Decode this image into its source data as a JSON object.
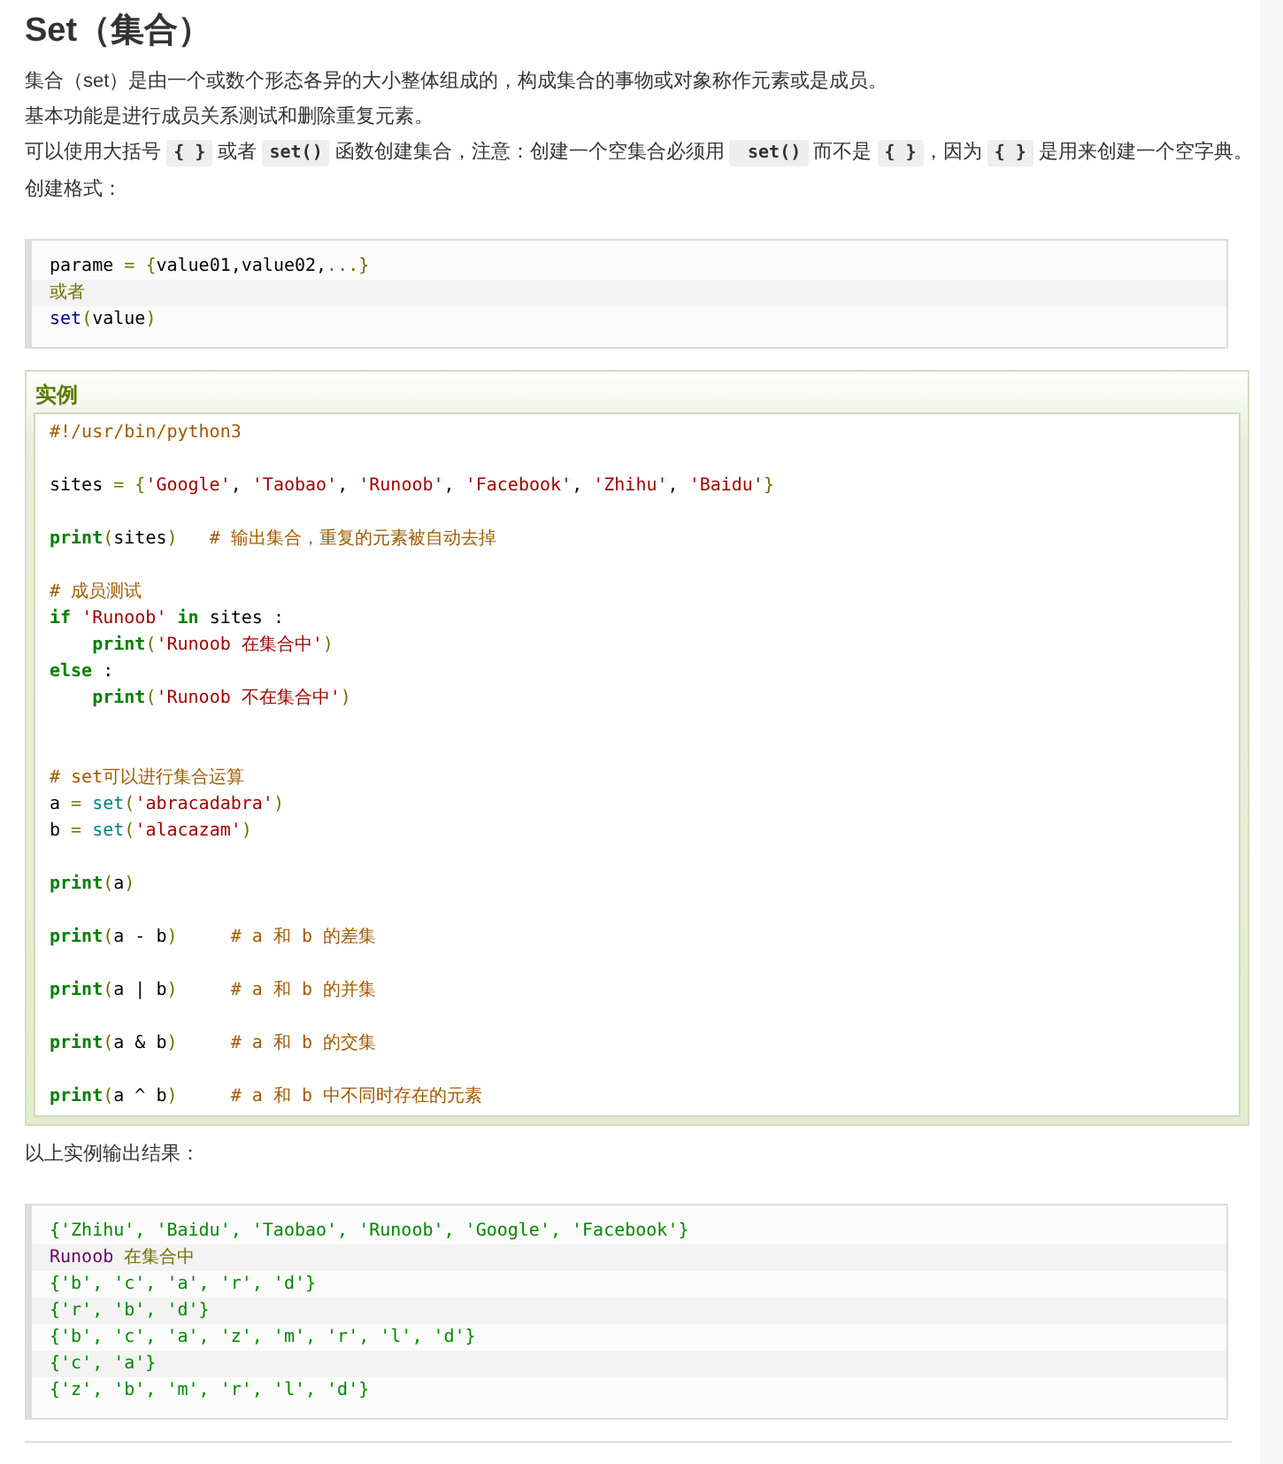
{
  "title": "Set（集合）",
  "paragraphs": [
    [
      {
        "kind": "text",
        "text": "集合（set）是由一个或数个形态各异的大小整体组成的，构成集合的事物或对象称作元素或是成员。"
      }
    ],
    [
      {
        "kind": "text",
        "text": "基本功能是进行成员关系测试和删除重复元素。"
      }
    ],
    [
      {
        "kind": "text",
        "text": "可以使用大括号 "
      },
      {
        "kind": "code",
        "text": "{ }"
      },
      {
        "kind": "text",
        "text": " 或者 "
      },
      {
        "kind": "code",
        "text": "set()"
      },
      {
        "kind": "text",
        "text": " 函数创建集合，注意：创建一个空集合必须用 "
      },
      {
        "kind": "code",
        "text": " set()"
      },
      {
        "kind": "text",
        "text": " 而不是 "
      },
      {
        "kind": "code",
        "text": "{ }"
      },
      {
        "kind": "text",
        "text": "，因为 "
      },
      {
        "kind": "code",
        "text": "{ }"
      },
      {
        "kind": "text",
        "text": " 是用来创建一个空字典。"
      }
    ],
    [
      {
        "kind": "text",
        "text": "创建格式："
      }
    ]
  ],
  "format_block": [
    {
      "tokens": [
        {
          "kind": "plain",
          "text": "parame "
        },
        {
          "kind": "op",
          "text": "= {"
        },
        {
          "kind": "plain",
          "text": "value01,value02,"
        },
        {
          "kind": "op",
          "text": "...}"
        }
      ]
    },
    {
      "tokens": [
        {
          "kind": "op",
          "text": "或者"
        }
      ]
    },
    {
      "tokens": [
        {
          "kind": "name",
          "text": "set"
        },
        {
          "kind": "op",
          "text": "("
        },
        {
          "kind": "plain",
          "text": "value"
        },
        {
          "kind": "op",
          "text": ")"
        }
      ]
    }
  ],
  "example": {
    "label": "实例",
    "lines": [
      {
        "tokens": [
          {
            "kind": "comment",
            "text": "#!/usr/bin/python3"
          }
        ],
        "blank_after": true
      },
      {
        "tokens": [
          {
            "kind": "plain",
            "text": "sites "
          },
          {
            "kind": "op",
            "text": "= {"
          },
          {
            "kind": "string",
            "text": "'Google'"
          },
          {
            "kind": "plain",
            "text": ", "
          },
          {
            "kind": "string",
            "text": "'Taobao'"
          },
          {
            "kind": "plain",
            "text": ", "
          },
          {
            "kind": "string",
            "text": "'Runoob'"
          },
          {
            "kind": "plain",
            "text": ", "
          },
          {
            "kind": "string",
            "text": "'Facebook'"
          },
          {
            "kind": "plain",
            "text": ", "
          },
          {
            "kind": "string",
            "text": "'Zhihu'"
          },
          {
            "kind": "plain",
            "text": ", "
          },
          {
            "kind": "string",
            "text": "'Baidu'"
          },
          {
            "kind": "op",
            "text": "}"
          }
        ],
        "blank_after": true
      },
      {
        "tokens": [
          {
            "kind": "keyword",
            "text": "print"
          },
          {
            "kind": "op",
            "text": "("
          },
          {
            "kind": "plain",
            "text": "sites"
          },
          {
            "kind": "op",
            "text": ")"
          },
          {
            "kind": "comment",
            "text": "   # 输出集合，重复的元素被自动去掉"
          }
        ],
        "blank_after": true
      },
      {
        "tokens": [
          {
            "kind": "comment",
            "text": "# 成员测试"
          }
        ]
      },
      {
        "tokens": [
          {
            "kind": "keyword",
            "text": "if "
          },
          {
            "kind": "string",
            "text": "'Runoob'"
          },
          {
            "kind": "keyword",
            "text": " in"
          },
          {
            "kind": "plain",
            "text": " sites :"
          }
        ]
      },
      {
        "tokens": [
          {
            "kind": "keyword",
            "text": "    print"
          },
          {
            "kind": "op",
            "text": "("
          },
          {
            "kind": "string",
            "text": "'Runoob 在集合中'"
          },
          {
            "kind": "op",
            "text": ")"
          }
        ]
      },
      {
        "tokens": [
          {
            "kind": "keyword",
            "text": "else"
          },
          {
            "kind": "plain",
            "text": " :"
          }
        ]
      },
      {
        "tokens": [
          {
            "kind": "keyword",
            "text": "    print"
          },
          {
            "kind": "op",
            "text": "("
          },
          {
            "kind": "string",
            "text": "'Runoob 不在集合中'"
          },
          {
            "kind": "op",
            "text": ")"
          }
        ],
        "blank_after": true
      },
      {
        "tokens": [
          {
            "kind": "comment",
            "text": "# set可以进行集合运算"
          }
        ],
        "blank_before": true
      },
      {
        "tokens": [
          {
            "kind": "plain",
            "text": "a "
          },
          {
            "kind": "op",
            "text": "= "
          },
          {
            "kind": "builtin",
            "text": "set"
          },
          {
            "kind": "op",
            "text": "("
          },
          {
            "kind": "string",
            "text": "'abracadabra'"
          },
          {
            "kind": "op",
            "text": ")"
          }
        ]
      },
      {
        "tokens": [
          {
            "kind": "plain",
            "text": "b "
          },
          {
            "kind": "op",
            "text": "= "
          },
          {
            "kind": "builtin",
            "text": "set"
          },
          {
            "kind": "op",
            "text": "("
          },
          {
            "kind": "string",
            "text": "'alacazam'"
          },
          {
            "kind": "op",
            "text": ")"
          }
        ],
        "blank_after": true
      },
      {
        "tokens": [
          {
            "kind": "keyword",
            "text": "print"
          },
          {
            "kind": "op",
            "text": "("
          },
          {
            "kind": "plain",
            "text": "a"
          },
          {
            "kind": "op",
            "text": ")"
          }
        ],
        "blank_after": true
      },
      {
        "tokens": [
          {
            "kind": "keyword",
            "text": "print"
          },
          {
            "kind": "op",
            "text": "("
          },
          {
            "kind": "plain",
            "text": "a - b"
          },
          {
            "kind": "op",
            "text": ")"
          },
          {
            "kind": "comment",
            "text": "     # a 和 b 的差集"
          }
        ],
        "blank_after": true
      },
      {
        "tokens": [
          {
            "kind": "keyword",
            "text": "print"
          },
          {
            "kind": "op",
            "text": "("
          },
          {
            "kind": "plain",
            "text": "a | b"
          },
          {
            "kind": "op",
            "text": ")"
          },
          {
            "kind": "comment",
            "text": "     # a 和 b 的并集"
          }
        ],
        "blank_after": true
      },
      {
        "tokens": [
          {
            "kind": "keyword",
            "text": "print"
          },
          {
            "kind": "op",
            "text": "("
          },
          {
            "kind": "plain",
            "text": "a & b"
          },
          {
            "kind": "op",
            "text": ")"
          },
          {
            "kind": "comment",
            "text": "     # a 和 b 的交集"
          }
        ],
        "blank_after": true
      },
      {
        "tokens": [
          {
            "kind": "keyword",
            "text": "print"
          },
          {
            "kind": "op",
            "text": "("
          },
          {
            "kind": "plain",
            "text": "a ^ b"
          },
          {
            "kind": "op",
            "text": ")"
          },
          {
            "kind": "comment",
            "text": "     # a 和 b 中不同时存在的元素"
          }
        ]
      }
    ]
  },
  "output_intro": "以上实例输出结果：",
  "output_block": [
    {
      "tokens": [
        {
          "kind": "green",
          "text": "{'Zhihu', 'Baidu', 'Taobao', 'Runoob', 'Google', 'Facebook'}"
        }
      ]
    },
    {
      "tokens": [
        {
          "kind": "purple",
          "text": "Runoob"
        },
        {
          "kind": "op",
          "text": " 在集合中"
        }
      ]
    },
    {
      "tokens": [
        {
          "kind": "green",
          "text": "{'b', 'c', 'a', 'r', 'd'}"
        }
      ]
    },
    {
      "tokens": [
        {
          "kind": "green",
          "text": "{'r', 'b', 'd'}"
        }
      ]
    },
    {
      "tokens": [
        {
          "kind": "green",
          "text": "{'b', 'c', 'a', 'z', 'm', 'r', 'l', 'd'}"
        }
      ]
    },
    {
      "tokens": [
        {
          "kind": "green",
          "text": "{'c', 'a'}"
        }
      ]
    },
    {
      "tokens": [
        {
          "kind": "green",
          "text": "{'z', 'b', 'm', 'r', 'l', 'd'}"
        }
      ]
    }
  ]
}
